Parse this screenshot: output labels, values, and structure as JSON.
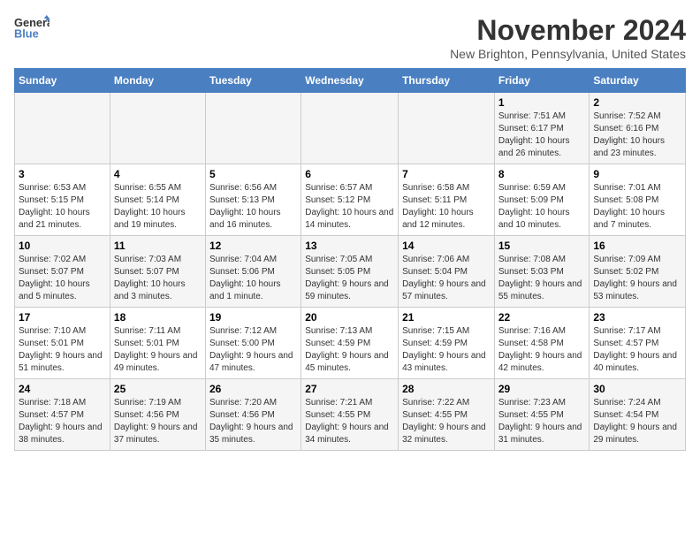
{
  "logo": {
    "general": "General",
    "blue": "Blue"
  },
  "header": {
    "month_year": "November 2024",
    "location": "New Brighton, Pennsylvania, United States"
  },
  "days_of_week": [
    "Sunday",
    "Monday",
    "Tuesday",
    "Wednesday",
    "Thursday",
    "Friday",
    "Saturday"
  ],
  "weeks": [
    [
      {
        "day": "",
        "info": ""
      },
      {
        "day": "",
        "info": ""
      },
      {
        "day": "",
        "info": ""
      },
      {
        "day": "",
        "info": ""
      },
      {
        "day": "",
        "info": ""
      },
      {
        "day": "1",
        "info": "Sunrise: 7:51 AM\nSunset: 6:17 PM\nDaylight: 10 hours and 26 minutes."
      },
      {
        "day": "2",
        "info": "Sunrise: 7:52 AM\nSunset: 6:16 PM\nDaylight: 10 hours and 23 minutes."
      }
    ],
    [
      {
        "day": "3",
        "info": "Sunrise: 6:53 AM\nSunset: 5:15 PM\nDaylight: 10 hours and 21 minutes."
      },
      {
        "day": "4",
        "info": "Sunrise: 6:55 AM\nSunset: 5:14 PM\nDaylight: 10 hours and 19 minutes."
      },
      {
        "day": "5",
        "info": "Sunrise: 6:56 AM\nSunset: 5:13 PM\nDaylight: 10 hours and 16 minutes."
      },
      {
        "day": "6",
        "info": "Sunrise: 6:57 AM\nSunset: 5:12 PM\nDaylight: 10 hours and 14 minutes."
      },
      {
        "day": "7",
        "info": "Sunrise: 6:58 AM\nSunset: 5:11 PM\nDaylight: 10 hours and 12 minutes."
      },
      {
        "day": "8",
        "info": "Sunrise: 6:59 AM\nSunset: 5:09 PM\nDaylight: 10 hours and 10 minutes."
      },
      {
        "day": "9",
        "info": "Sunrise: 7:01 AM\nSunset: 5:08 PM\nDaylight: 10 hours and 7 minutes."
      }
    ],
    [
      {
        "day": "10",
        "info": "Sunrise: 7:02 AM\nSunset: 5:07 PM\nDaylight: 10 hours and 5 minutes."
      },
      {
        "day": "11",
        "info": "Sunrise: 7:03 AM\nSunset: 5:07 PM\nDaylight: 10 hours and 3 minutes."
      },
      {
        "day": "12",
        "info": "Sunrise: 7:04 AM\nSunset: 5:06 PM\nDaylight: 10 hours and 1 minute."
      },
      {
        "day": "13",
        "info": "Sunrise: 7:05 AM\nSunset: 5:05 PM\nDaylight: 9 hours and 59 minutes."
      },
      {
        "day": "14",
        "info": "Sunrise: 7:06 AM\nSunset: 5:04 PM\nDaylight: 9 hours and 57 minutes."
      },
      {
        "day": "15",
        "info": "Sunrise: 7:08 AM\nSunset: 5:03 PM\nDaylight: 9 hours and 55 minutes."
      },
      {
        "day": "16",
        "info": "Sunrise: 7:09 AM\nSunset: 5:02 PM\nDaylight: 9 hours and 53 minutes."
      }
    ],
    [
      {
        "day": "17",
        "info": "Sunrise: 7:10 AM\nSunset: 5:01 PM\nDaylight: 9 hours and 51 minutes."
      },
      {
        "day": "18",
        "info": "Sunrise: 7:11 AM\nSunset: 5:01 PM\nDaylight: 9 hours and 49 minutes."
      },
      {
        "day": "19",
        "info": "Sunrise: 7:12 AM\nSunset: 5:00 PM\nDaylight: 9 hours and 47 minutes."
      },
      {
        "day": "20",
        "info": "Sunrise: 7:13 AM\nSunset: 4:59 PM\nDaylight: 9 hours and 45 minutes."
      },
      {
        "day": "21",
        "info": "Sunrise: 7:15 AM\nSunset: 4:59 PM\nDaylight: 9 hours and 43 minutes."
      },
      {
        "day": "22",
        "info": "Sunrise: 7:16 AM\nSunset: 4:58 PM\nDaylight: 9 hours and 42 minutes."
      },
      {
        "day": "23",
        "info": "Sunrise: 7:17 AM\nSunset: 4:57 PM\nDaylight: 9 hours and 40 minutes."
      }
    ],
    [
      {
        "day": "24",
        "info": "Sunrise: 7:18 AM\nSunset: 4:57 PM\nDaylight: 9 hours and 38 minutes."
      },
      {
        "day": "25",
        "info": "Sunrise: 7:19 AM\nSunset: 4:56 PM\nDaylight: 9 hours and 37 minutes."
      },
      {
        "day": "26",
        "info": "Sunrise: 7:20 AM\nSunset: 4:56 PM\nDaylight: 9 hours and 35 minutes."
      },
      {
        "day": "27",
        "info": "Sunrise: 7:21 AM\nSunset: 4:55 PM\nDaylight: 9 hours and 34 minutes."
      },
      {
        "day": "28",
        "info": "Sunrise: 7:22 AM\nSunset: 4:55 PM\nDaylight: 9 hours and 32 minutes."
      },
      {
        "day": "29",
        "info": "Sunrise: 7:23 AM\nSunset: 4:55 PM\nDaylight: 9 hours and 31 minutes."
      },
      {
        "day": "30",
        "info": "Sunrise: 7:24 AM\nSunset: 4:54 PM\nDaylight: 9 hours and 29 minutes."
      }
    ]
  ]
}
